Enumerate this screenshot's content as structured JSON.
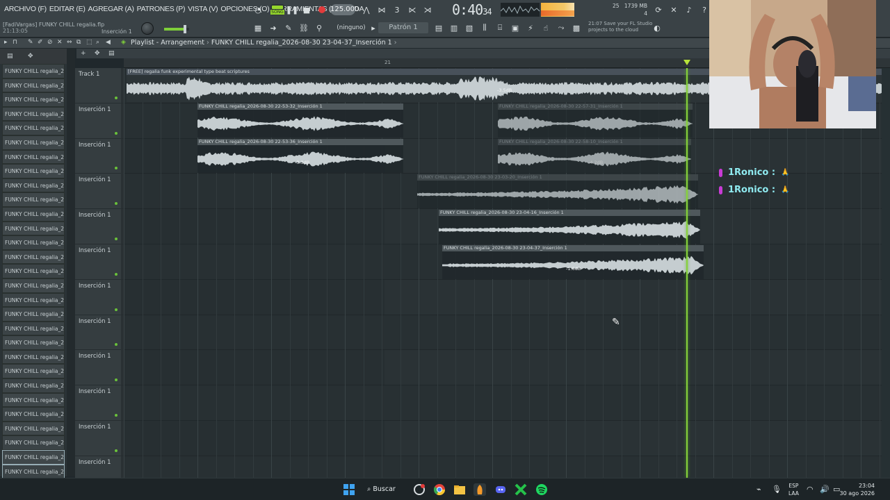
{
  "menu": [
    "ARCHIVO (F)",
    "EDITAR (E)",
    "AGREGAR (A)",
    "PATRONES (P)",
    "VISTA (V)",
    "OPCIONES (O)",
    "HERRAMIENTAS (T)",
    "AYUDA"
  ],
  "project": {
    "user_file": "[FadiVargas] FUNKY CHILL regalia.flp",
    "elapsed": "21:13:05",
    "insert": "Inserción 1"
  },
  "transport": {
    "song_label": "SONG",
    "tempo": "125.000",
    "time_main": "0:40",
    "time_ms": "34"
  },
  "stats": {
    "cpu_value": "25",
    "memory": "1739 MB",
    "polyphony": "4"
  },
  "toolbar": {
    "snap": "(ninguno)",
    "pattern": "Patrón 1",
    "news_time": "21:07",
    "news_text": "Save your FL Studio projects to the cloud"
  },
  "playlist": {
    "title_prefix": "Playlist - Arrangement",
    "separator": "›",
    "title_clip": "FUNKY CHILL regalia_2026-08-30 23-04-37_Inserción 1",
    "end_arrow": "›",
    "ruler_bar": "21"
  },
  "browser_items": [
    "FUNKY CHILL regalia_202...",
    "FUNKY CHILL regalia_202...",
    "FUNKY CHILL regalia_202...",
    "FUNKY CHILL regalia_202...",
    "FUNKY CHILL regalia_202...",
    "FUNKY CHILL regalia_202...",
    "FUNKY CHILL regalia_202...",
    "FUNKY CHILL regalia_202...",
    "FUNKY CHILL regalia_202...",
    "FUNKY CHILL regalia_202...",
    "FUNKY CHILL regalia_202...",
    "FUNKY CHILL regalia_202...",
    "FUNKY CHILL regalia_202...",
    "FUNKY CHILL regalia_202...",
    "FUNKY CHILL regalia_202...",
    "FUNKY CHILL regalia_202...",
    "FUNKY CHILL regalia_202...",
    "FUNKY CHILL regalia_202...",
    "FUNKY CHILL regalia_202...",
    "FUNKY CHILL regalia_202...",
    "FUNKY CHILL regalia_202...",
    "FUNKY CHILL regalia_202...",
    "FUNKY CHILL regalia_202...",
    "FUNKY CHILL regalia_202...",
    "FUNKY CHILL regalia_202...",
    "FUNKY CHILL regalia_202...",
    "FUNKY CHILL regalia_202...",
    "FUNKY CHILL regalia_202...",
    "FUNKY CHILL regalia_202..."
  ],
  "tracks": [
    "Track 1",
    "Inserción 1",
    "Inserción 1",
    "Inserción 1",
    "Inserción 1",
    "Inserción 1",
    "Inserción 1",
    "Inserción 1",
    "Inserción 1",
    "Inserción 1",
    "Inserción 1",
    "Inserción 1"
  ],
  "clips": {
    "track1": {
      "title": "[FREE] regalia  funk  experimental type beat  scriptures",
      "db": "-3.5dB"
    },
    "c1": {
      "title": "FUNKY CHILL regalia_2026-08-30 22-53-32_Inserción 1"
    },
    "c2": {
      "title": "FUNKY CHILL regalia_2026-08-30 22-57-31_Inserción 1"
    },
    "c3": {
      "title": "FUNKY CHILL regalia_2026-08-30 22-53-36_Inserción 1",
      "db": "-3.3dB"
    },
    "c4": {
      "title": "FUNKY CHILL regalia_2026-08-30 22-58-10_Inserción 1",
      "db": "-4.2dB"
    },
    "c5": {
      "title": "FUNKY CHILL regalia_2026-08-30 23-03-20_Inserción 1"
    },
    "c6": {
      "title": "FUNKY CHILL regalia_2026-08-30 23-04-16_Inserción 1"
    },
    "c7": {
      "title": "FUNKY CHILL regalia_2026-08-30 23-04-37_Inserción 1",
      "db": "-1.6dB"
    }
  },
  "chat": [
    {
      "user": "1Ronico :",
      "emote": "🙏"
    },
    {
      "user": "1Ronico :",
      "emote": "🙏"
    }
  ],
  "taskbar": {
    "search": "Buscar",
    "lang_top": "ESP",
    "lang_bottom": "LAA",
    "time": "23:04",
    "date": "30 ago 2026"
  }
}
